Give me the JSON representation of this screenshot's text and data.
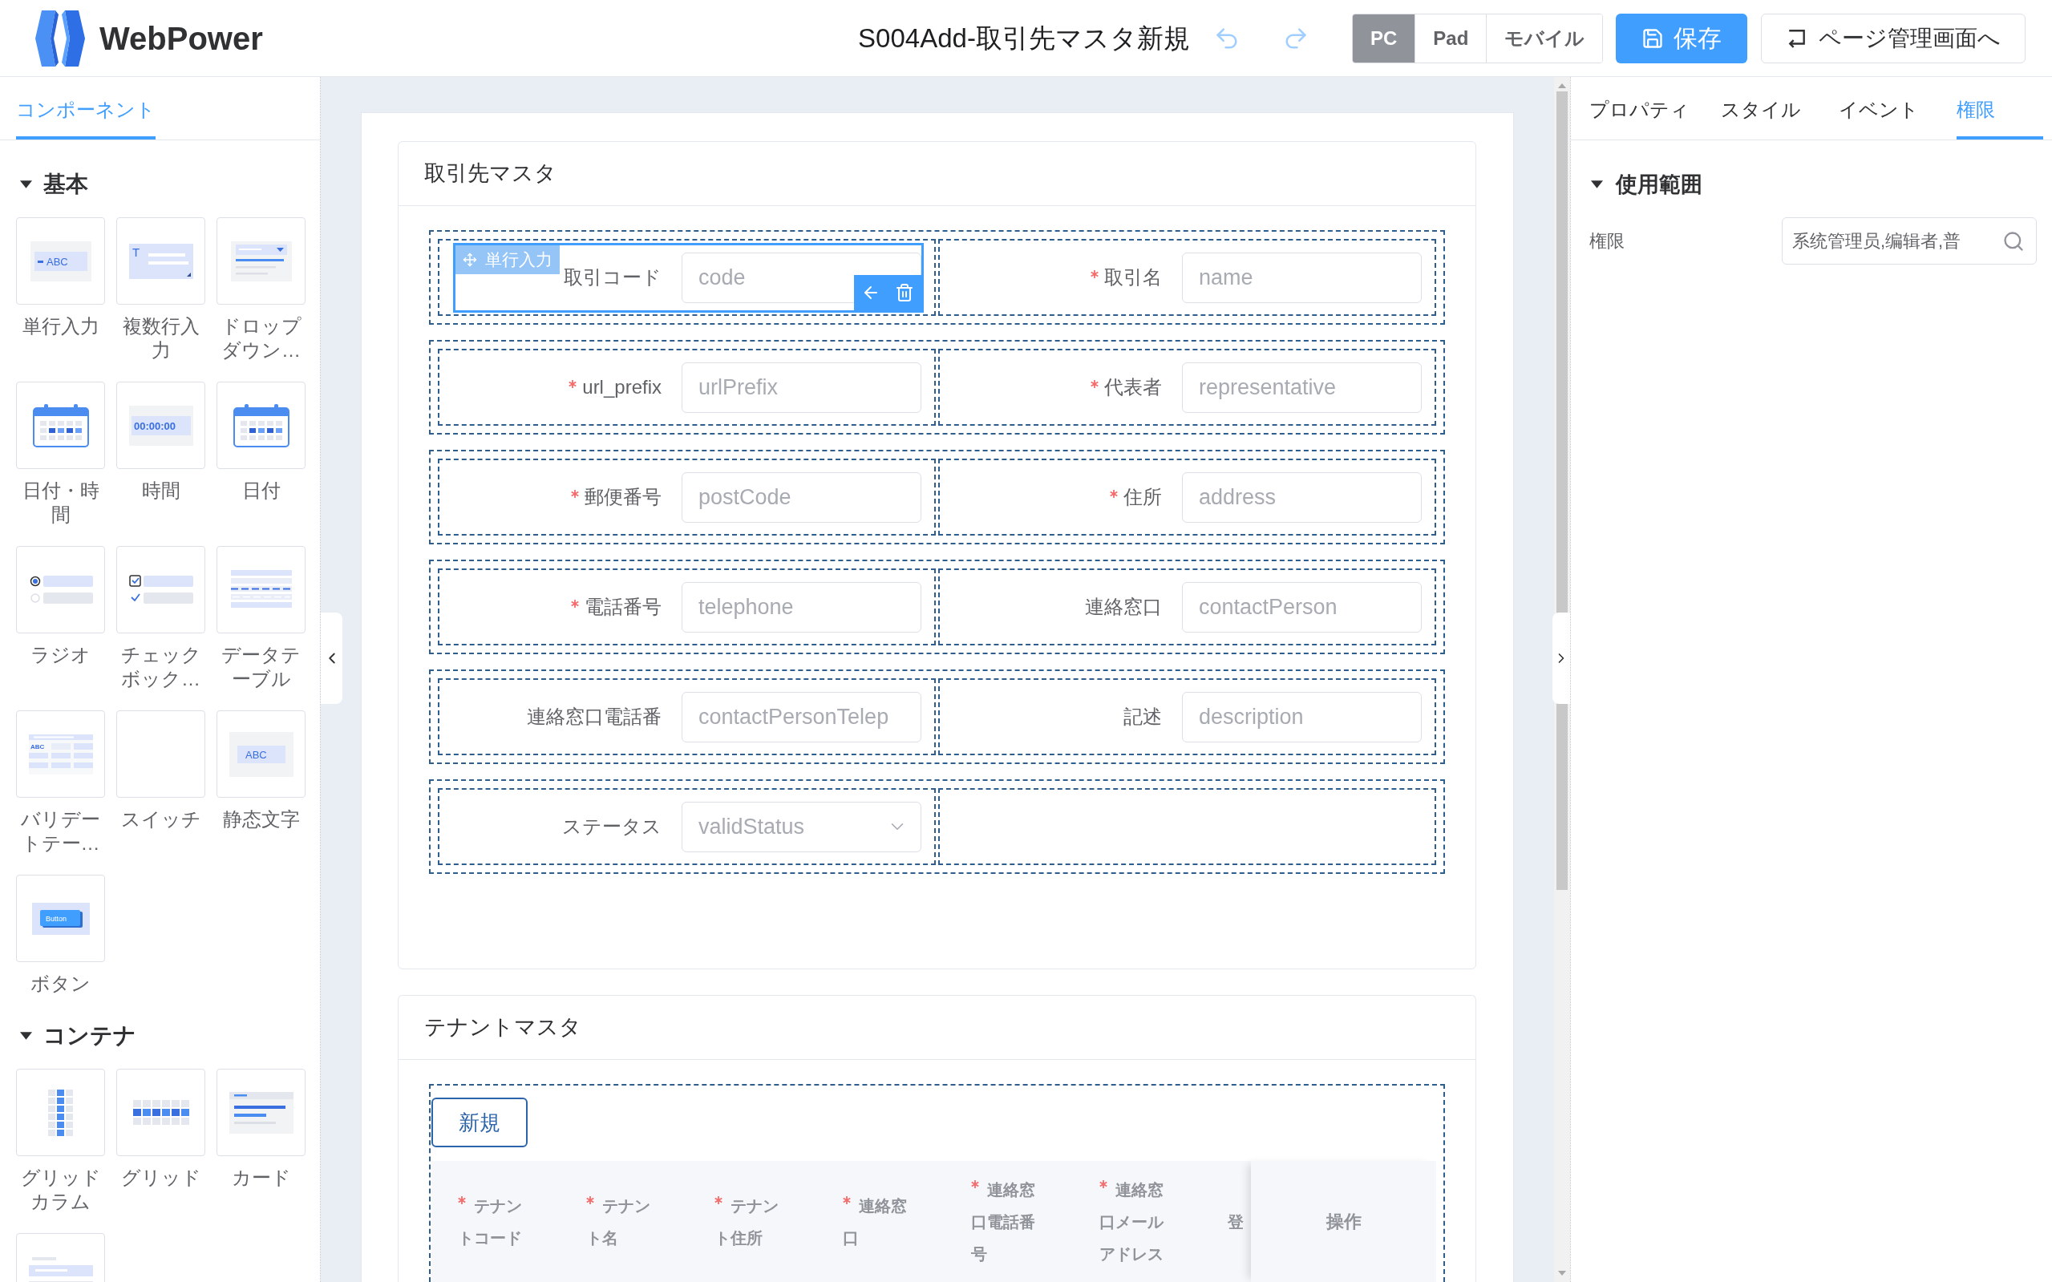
{
  "header": {
    "logo_text": "WebPower",
    "title": "S004Add-取引先マスタ新規",
    "devices": [
      {
        "label": "PC",
        "selected": true
      },
      {
        "label": "Pad",
        "selected": false
      },
      {
        "label": "モバイル",
        "selected": false
      }
    ],
    "save_button": "保存",
    "back_button": "ページ管理画面へ"
  },
  "left_panel": {
    "tabs": [
      {
        "label": "コンポーネント",
        "selected": true
      }
    ],
    "sections": [
      {
        "title": "基本",
        "expanded": true,
        "items": [
          {
            "kind": "text-input",
            "label": "単行入力",
            "icon_text": "ABC"
          },
          {
            "kind": "textarea",
            "label": "複数行入力",
            "icon_text": "T"
          },
          {
            "kind": "dropdown",
            "label": "ドロップダウン…"
          },
          {
            "kind": "datetime",
            "label": "日付・時間"
          },
          {
            "kind": "time",
            "label": "時間",
            "icon_text": "00:00:00"
          },
          {
            "kind": "date",
            "label": "日付"
          },
          {
            "kind": "radio",
            "label": "ラジオ"
          },
          {
            "kind": "checkbox",
            "label": "チェックボック…"
          },
          {
            "kind": "data-table",
            "label": "データテーブル"
          },
          {
            "kind": "validation-table",
            "label": "バリデートテー…",
            "icon_text": "ABC"
          },
          {
            "kind": "switch",
            "label": "スイッチ"
          },
          {
            "kind": "static-text",
            "label": "静态文字",
            "icon_text": "ABC"
          },
          {
            "kind": "button",
            "label": "ボタン",
            "icon_text": "Button"
          }
        ]
      },
      {
        "title": "コンテナ",
        "expanded": true,
        "items": [
          {
            "kind": "grid-column",
            "label": "グリッドカラム"
          },
          {
            "kind": "grid",
            "label": "グリッド"
          },
          {
            "kind": "card",
            "label": "カード"
          },
          {
            "kind": "panel"
          }
        ]
      }
    ]
  },
  "canvas": {
    "form_card": {
      "title": "取引先マスタ",
      "rows": [
        {
          "fields": [
            {
              "kind": "input",
              "label": "取引コード",
              "required": false,
              "placeholder": "code",
              "selected": true,
              "tag": "単行入力"
            },
            {
              "kind": "input",
              "label": "取引名",
              "required": true,
              "placeholder": "name",
              "selected": false
            }
          ]
        },
        {
          "fields": [
            {
              "kind": "input",
              "label": "url_prefix",
              "required": true,
              "placeholder": "urlPrefix",
              "selected": false
            },
            {
              "kind": "input",
              "label": "代表者",
              "required": true,
              "placeholder": "representative",
              "selected": false
            }
          ]
        },
        {
          "fields": [
            {
              "kind": "input",
              "label": "郵便番号",
              "required": true,
              "placeholder": "postCode",
              "selected": false
            },
            {
              "kind": "input",
              "label": "住所",
              "required": true,
              "placeholder": "address",
              "selected": false
            }
          ]
        },
        {
          "fields": [
            {
              "kind": "input",
              "label": "電話番号",
              "required": true,
              "placeholder": "telephone",
              "selected": false
            },
            {
              "kind": "input",
              "label": "連絡窓口",
              "required": false,
              "placeholder": "contactPerson",
              "selected": false
            }
          ]
        },
        {
          "fields": [
            {
              "kind": "input",
              "label": "連絡窓口電話番",
              "required": false,
              "placeholder": "contactPersonTelep",
              "selected": false
            },
            {
              "kind": "input",
              "label": "記述",
              "required": false,
              "placeholder": "description",
              "selected": false
            }
          ]
        },
        {
          "fields": [
            {
              "kind": "select",
              "label": "ステータス",
              "required": false,
              "placeholder": "validStatus",
              "selected": false
            }
          ]
        }
      ]
    },
    "tenant_card": {
      "title": "テナントマスタ",
      "new_button": "新規",
      "columns": [
        {
          "label": "テナントコード",
          "required": true
        },
        {
          "label": "テナント名",
          "required": true
        },
        {
          "label": "テナント住所",
          "required": true
        },
        {
          "label": "連絡窓口",
          "required": true
        },
        {
          "label": "連絡窓口電話番号",
          "required": true
        },
        {
          "label": "連絡窓口メールアドレス",
          "required": true
        },
        {
          "label": "登",
          "required": false
        }
      ],
      "action_column": "操作"
    }
  },
  "right_panel": {
    "tabs": [
      {
        "label": "プロパティ",
        "selected": false
      },
      {
        "label": "スタイル",
        "selected": false
      },
      {
        "label": "イベント",
        "selected": false
      },
      {
        "label": "権限",
        "selected": true
      }
    ],
    "section": {
      "title": "使用範囲",
      "expanded": true,
      "fields": [
        {
          "label": "権限",
          "value": "系统管理员,编辑者,普"
        }
      ]
    }
  }
}
